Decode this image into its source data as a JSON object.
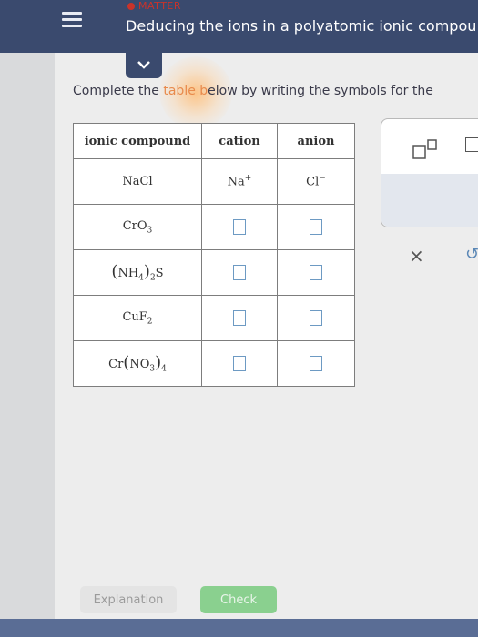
{
  "header": {
    "topic": "MATTER",
    "title": "Deducing the ions in a polyatomic ionic compou"
  },
  "instructions": {
    "before": "Complete the ",
    "highlight": "table",
    "middle": " ",
    "faded": "b",
    "after": "elow by writing the symbols for the"
  },
  "table": {
    "headers": [
      "ionic compound",
      "cation",
      "anion"
    ],
    "rows": [
      {
        "compound": "NaCl",
        "cation": "Na",
        "cation_charge": "+",
        "anion": "Cl",
        "anion_charge": "−"
      },
      {
        "compound_base": "CrO",
        "compound_sub": "3"
      },
      {
        "compound_open": "(",
        "compound_core": "NH",
        "compound_core_sub": "4",
        "compound_close": ")",
        "compound_close_sub": "2",
        "compound_tail": "S"
      },
      {
        "compound_base": "CuF",
        "compound_sub": "2"
      },
      {
        "compound_head": "Cr",
        "compound_open": "(",
        "compound_core": "NO",
        "compound_core_sub": "3",
        "compound_close": ")",
        "compound_close_sub": "4"
      }
    ]
  },
  "palette": {
    "clear_symbol": "×",
    "undo_symbol": "↺"
  },
  "buttons": {
    "explanation": "Explanation",
    "check": "Check"
  },
  "colors": {
    "header_bg": "#3a4a6e",
    "accent_red": "#c9332a",
    "check_green": "#8ad08f",
    "answer_box_border": "#6d9ac3"
  },
  "icons": [
    "menu-icon",
    "chevron-down-icon",
    "superscript-icon",
    "square-icon",
    "clear-icon",
    "undo-icon"
  ]
}
